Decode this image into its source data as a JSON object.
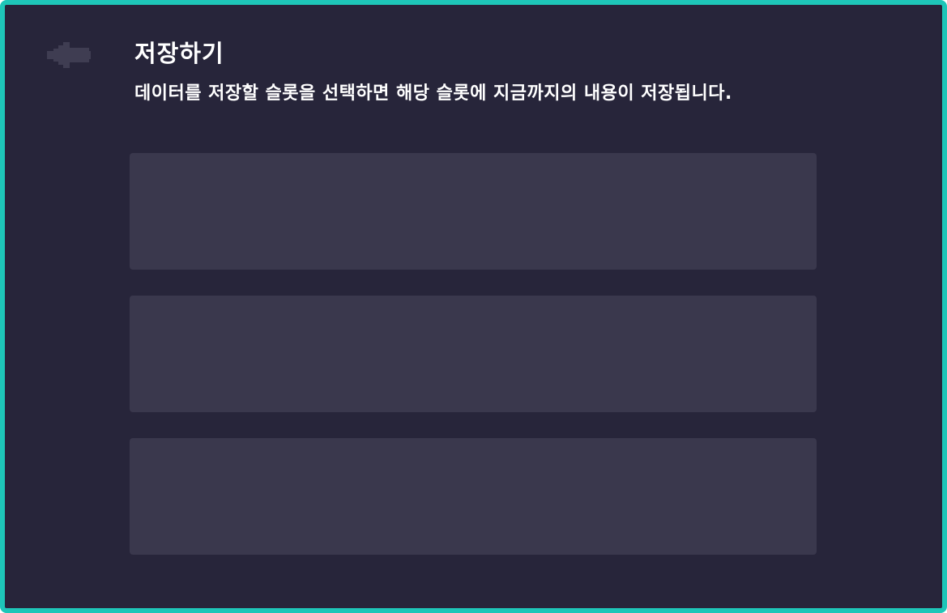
{
  "header": {
    "back_icon": "back-arrow-icon",
    "title": "저장하기"
  },
  "description": "데이터를 저장할 슬롯을 선택하면 해당 슬롯에 지금까지의 내용이 저장됩니다.",
  "save_slots": [
    {
      "label": ""
    },
    {
      "label": ""
    },
    {
      "label": ""
    }
  ],
  "colors": {
    "frame_border": "#1ec6b8",
    "background": "#27253a",
    "slot": "#3a384d",
    "back_icon": "#3f3d52",
    "text": "#ffffff"
  }
}
